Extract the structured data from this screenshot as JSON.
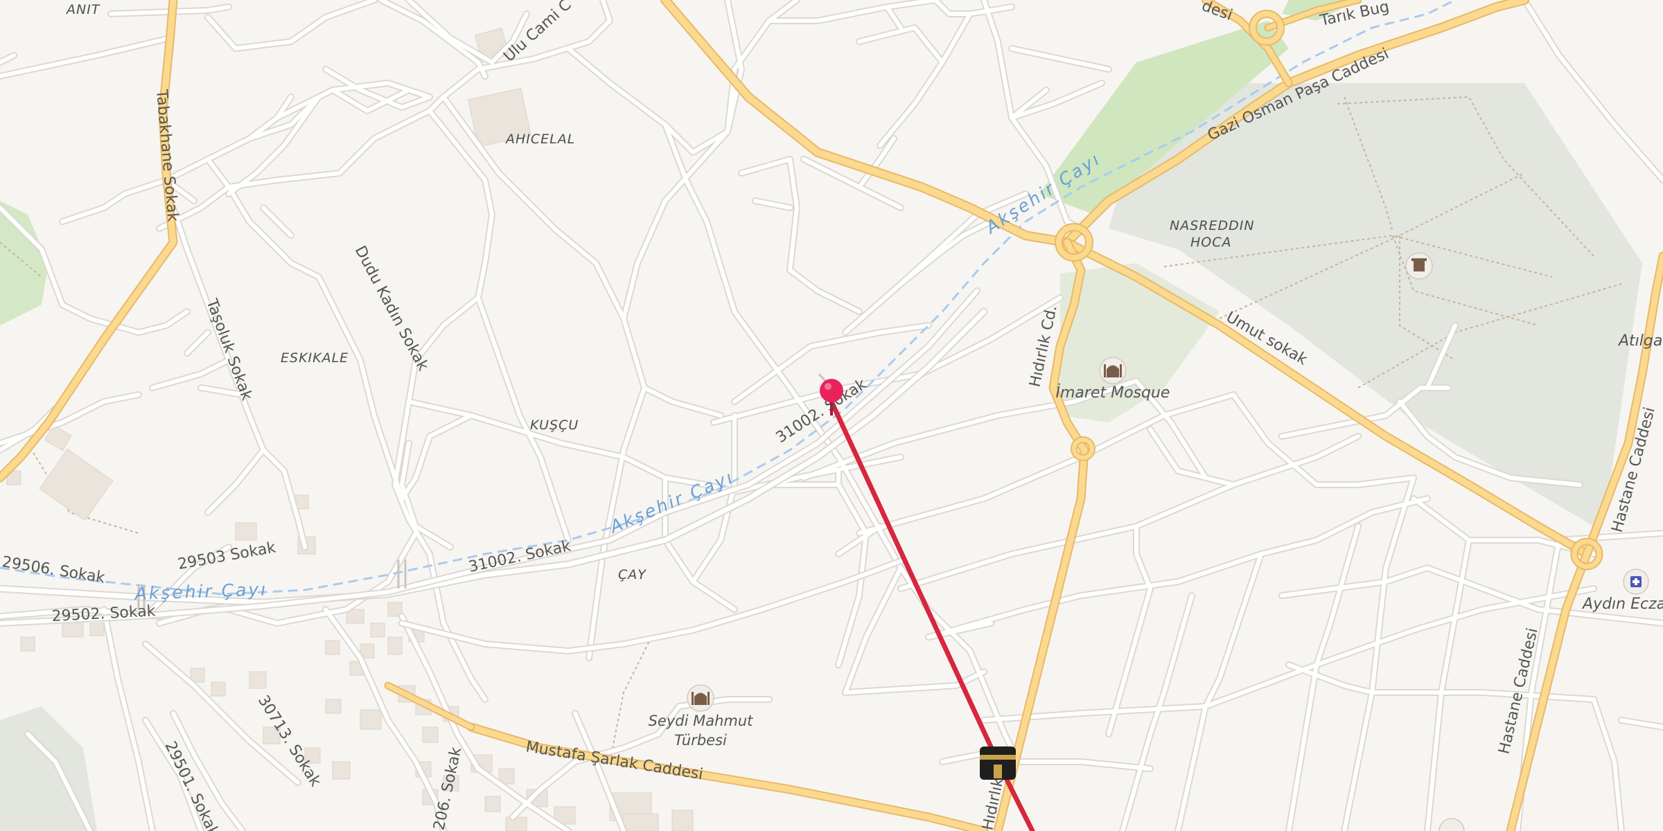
{
  "map": {
    "colors": {
      "land": "#f7f5f1",
      "minor_road": "#ffffff",
      "minor_road_casing": "#dcd8d2",
      "major_road": "#fbd98f",
      "major_road_casing": "#e8b967",
      "park": "#e2e6df",
      "grass": "#cfe6bf",
      "river": "#a8cbee",
      "route": "#d7263d",
      "pin": "#e8235a",
      "building": "#ebe4dc",
      "label_text": "#555555",
      "river_label": "#6a9fd6"
    },
    "districts": [
      {
        "name": "ANIT"
      },
      {
        "name": "AHICELAL"
      },
      {
        "name": "ESKIKALE"
      },
      {
        "name": "KUŞÇU"
      },
      {
        "name": "ÇAY"
      },
      {
        "name": "NASREDDIN"
      },
      {
        "name": "HOCA"
      }
    ],
    "streets": [
      {
        "name": "Ulu Cami C"
      },
      {
        "name": "Tabakhane Sokak"
      },
      {
        "name": "Dudu Kadın Sokak"
      },
      {
        "name": "Taşoluk Sokak"
      },
      {
        "name": "31002. Sokak"
      },
      {
        "name": "31002. Sokak"
      },
      {
        "name": "29503 Sokak"
      },
      {
        "name": "29506. Sokak"
      },
      {
        "name": "29502. Sokak"
      },
      {
        "name": "Gazi Osman Paşa Caddesi"
      },
      {
        "name": "Tarık Bug"
      },
      {
        "name": "desi"
      },
      {
        "name": "Umut sokak"
      },
      {
        "name": "Hıdırlık Cd."
      },
      {
        "name": "Hıdırlık"
      },
      {
        "name": "Mustafa Şarlak Caddesi"
      },
      {
        "name": "30713. Sokak"
      },
      {
        "name": "29501. Sokak"
      },
      {
        "name": "206. Sokak"
      },
      {
        "name": "Hastane Caddesi"
      },
      {
        "name": "Hastane Caddesi"
      }
    ],
    "waterways": [
      {
        "name": "Akşehir Çayı"
      },
      {
        "name": "Akşehir Çayı"
      },
      {
        "name": "Akşehir Çayı"
      }
    ],
    "pois": [
      {
        "name": "İmaret Mosque",
        "icon": "mosque-icon"
      },
      {
        "name": "Seydi Mahmut",
        "name2": "Türbesi",
        "icon": "mosque-icon"
      },
      {
        "name": "Aydın Eczan",
        "icon": "pharmacy-icon"
      },
      {
        "name": "Atılgan",
        "icon": ""
      }
    ],
    "markers": {
      "pin": "location-pin-icon",
      "destination": "kaaba-icon",
      "park_poi": "monument-icon"
    }
  }
}
